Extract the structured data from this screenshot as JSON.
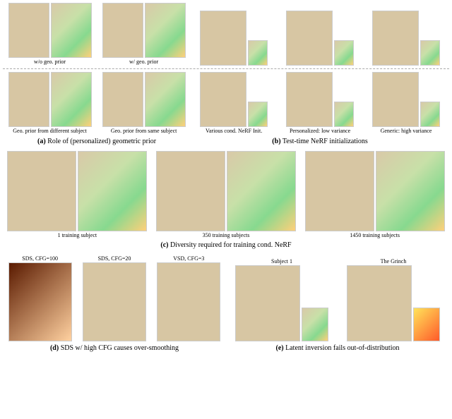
{
  "panel_a": {
    "caption_prefix": "(a)",
    "caption": "Role of (personalized) geometric prior",
    "top_labels": [
      "w/o geo. prior",
      "w/ geo. prior"
    ],
    "bot_labels": [
      "Geo. prior from different subject",
      "Geo. prior from same subject"
    ]
  },
  "panel_b": {
    "caption_prefix": "(b)",
    "caption": "Test-time NeRF initializations",
    "labels": [
      "Various cond. NeRF Init.",
      "Personalized: low variance",
      "Generic: high variance"
    ]
  },
  "panel_c": {
    "caption_prefix": "(c)",
    "caption": "Diversity required for training cond. NeRF",
    "labels": [
      "1 training subject",
      "350 training subjects",
      "1450 training subjects"
    ]
  },
  "panel_d": {
    "caption_prefix": "(d)",
    "caption": "SDS w/ high CFG causes over-smoothing",
    "labels": [
      "SDS, CFG=100",
      "SDS, CFG=20",
      "VSD, CFG=3"
    ]
  },
  "panel_e": {
    "caption_prefix": "(e)",
    "caption": "Latent inversion fails out-of-distribution",
    "labels": [
      "Subject 1",
      "The Grinch"
    ]
  }
}
